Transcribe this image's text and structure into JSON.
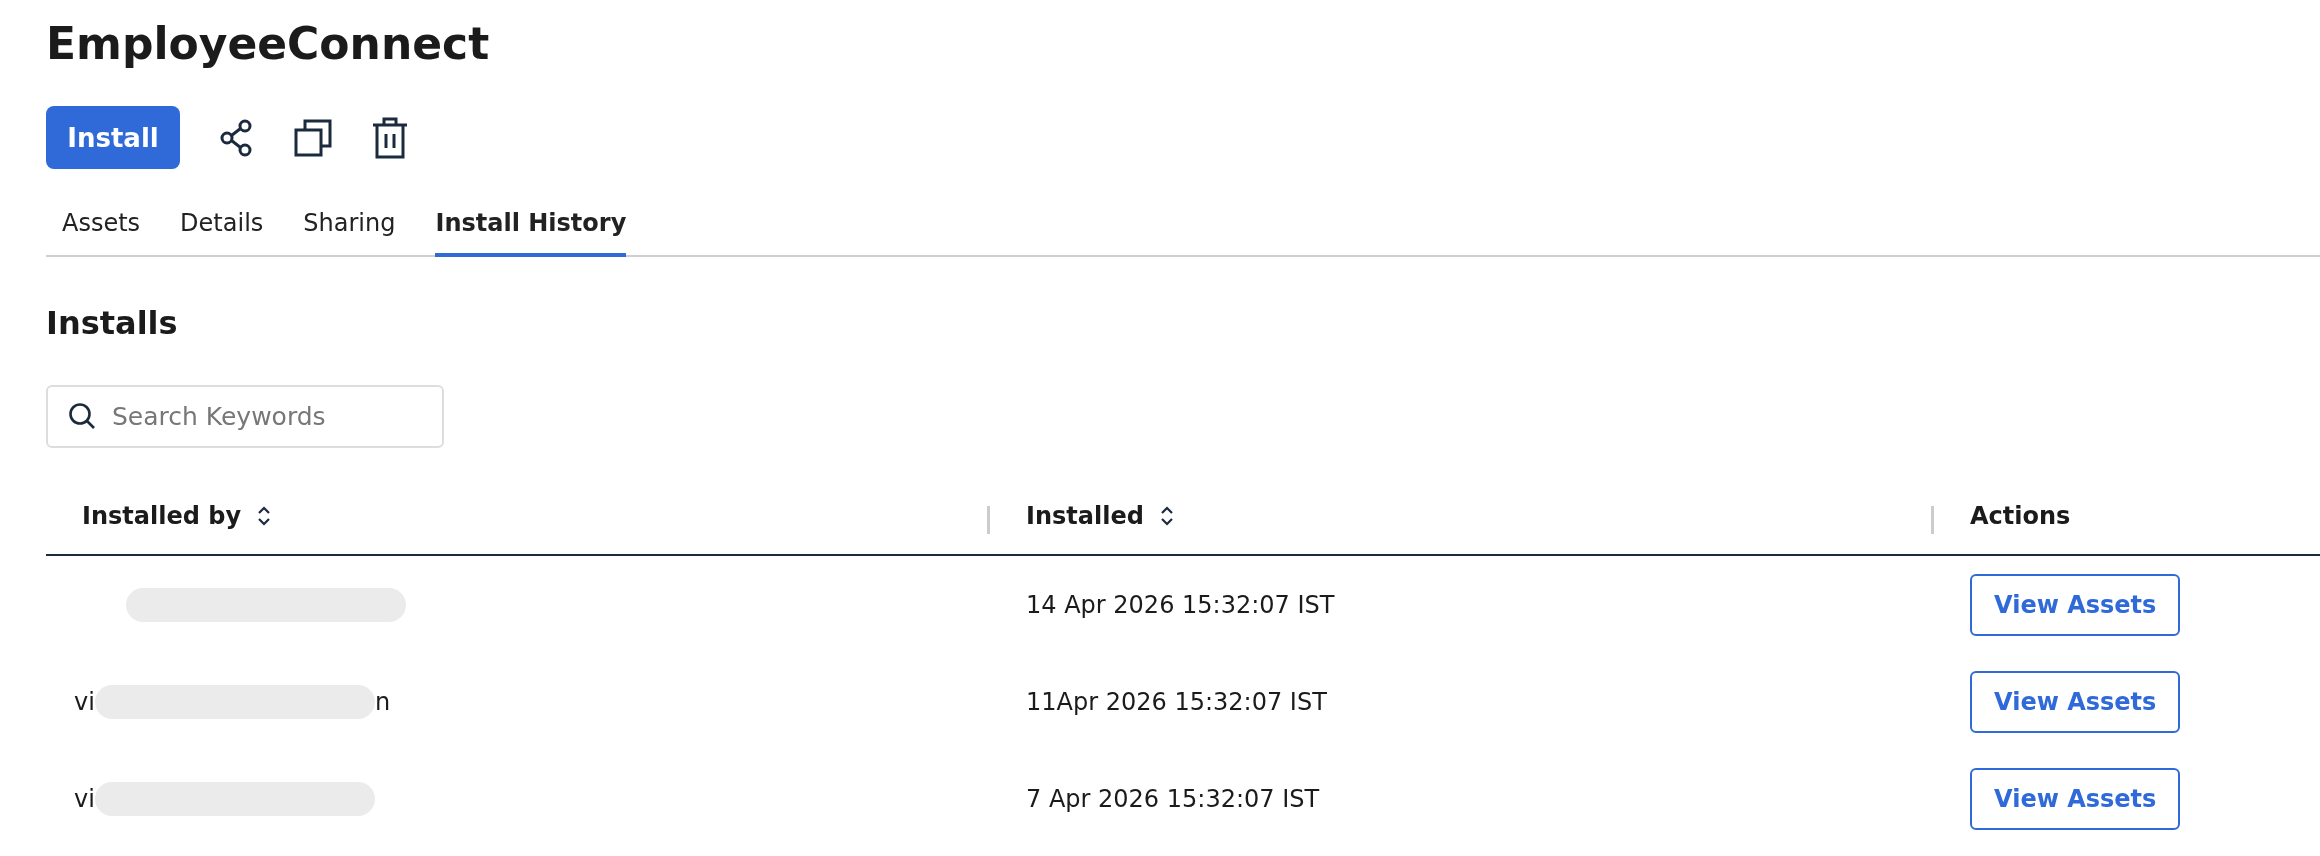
{
  "title": "EmployeeConnect",
  "toolbar": {
    "install_button": "Install"
  },
  "tabs": [
    {
      "label": "Assets",
      "selected": false
    },
    {
      "label": "Details",
      "selected": false
    },
    {
      "label": "Sharing",
      "selected": false
    },
    {
      "label": "Install History",
      "selected": true
    }
  ],
  "section_title": "Installs",
  "search": {
    "placeholder": "Search Keywords"
  },
  "table": {
    "columns": [
      "Installed by",
      "Installed",
      "Actions"
    ],
    "rows": [
      {
        "user_prefix": null,
        "user_suffix": null,
        "redacted": true,
        "installed": "14 Apr 2026 15:32:07 IST",
        "action": "View Assets"
      },
      {
        "user_prefix": "vi",
        "user_suffix": "n",
        "redacted": true,
        "installed": "11Apr 2026 15:32:07 IST",
        "action": "View Assets"
      },
      {
        "user_prefix": "vi",
        "user_suffix": null,
        "redacted": true,
        "installed": "7 Apr 2026 15:32:07 IST",
        "action": "View Assets"
      }
    ]
  }
}
